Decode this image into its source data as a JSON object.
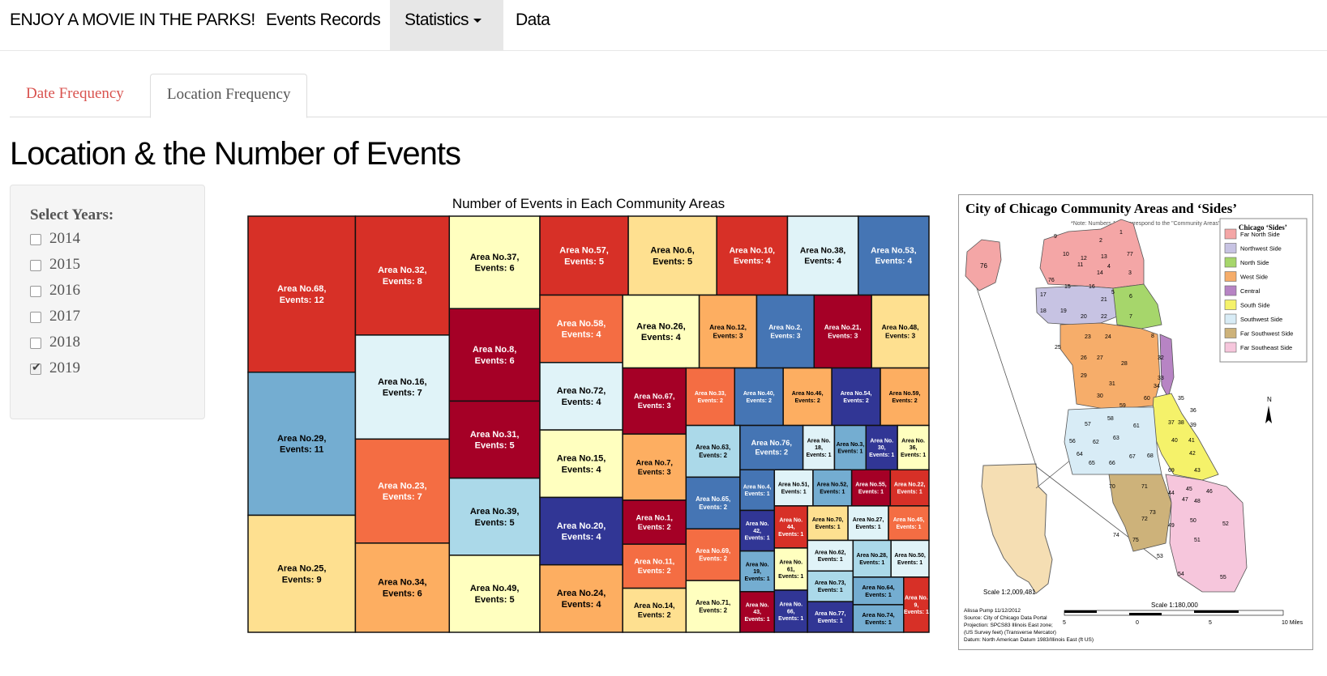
{
  "navbar": {
    "brand": "ENJOY A MOVIE IN THE PARKS!",
    "items": [
      {
        "label": "Events Records"
      },
      {
        "label": "Statistics"
      },
      {
        "label": "Data"
      }
    ]
  },
  "tabs": [
    {
      "label": "Date Frequency"
    },
    {
      "label": "Location Frequency",
      "active": true
    }
  ],
  "page_title": "Location & the Number of Events",
  "sidebar": {
    "label": "Select Years:",
    "years": [
      {
        "label": "2014",
        "checked": false
      },
      {
        "label": "2015",
        "checked": false
      },
      {
        "label": "2016",
        "checked": false
      },
      {
        "label": "2017",
        "checked": false
      },
      {
        "label": "2018",
        "checked": false
      },
      {
        "label": "2019",
        "checked": true
      }
    ]
  },
  "colors": {
    "dark_red": "#a50026",
    "red": "#d73027",
    "orange_red": "#f46d43",
    "orange": "#fdae61",
    "light_orange": "#fee090",
    "pale_yellow": "#ffffbf",
    "pale_blue": "#e0f3f8",
    "light_blue": "#abd9e9",
    "mid_blue": "#74add1",
    "blue": "#4575b4",
    "navy": "#313695"
  },
  "chart_data": {
    "type": "treemap",
    "title": "Number of Events in Each Community Areas",
    "items": [
      {
        "label": "Area No.68, Events: 12",
        "value": 12,
        "color": "#d73027"
      },
      {
        "label": "Area No.29, Events: 11",
        "value": 11,
        "color": "#74add1"
      },
      {
        "label": "Area No.25, Events: 9",
        "value": 9,
        "color": "#fee090"
      },
      {
        "label": "Area No.32, Events: 8",
        "value": 8,
        "color": "#d73027"
      },
      {
        "label": "Area No.16, Events: 7",
        "value": 7,
        "color": "#e0f3f8"
      },
      {
        "label": "Area No.23, Events: 7",
        "value": 7,
        "color": "#f46d43"
      },
      {
        "label": "Area No.34, Events: 6",
        "value": 6,
        "color": "#fdae61"
      },
      {
        "label": "Area No.37, Events: 6",
        "value": 6,
        "color": "#ffffbf"
      },
      {
        "label": "Area No.8, Events: 6",
        "value": 6,
        "color": "#a50026"
      },
      {
        "label": "Area No.31, Events: 5",
        "value": 5,
        "color": "#a50026"
      },
      {
        "label": "Area No.39, Events: 5",
        "value": 5,
        "color": "#abd9e9"
      },
      {
        "label": "Area No.49, Events: 5",
        "value": 5,
        "color": "#ffffbf"
      },
      {
        "label": "Area No.57, Events: 5",
        "value": 5,
        "color": "#d73027"
      },
      {
        "label": "Area No.6, Events: 5",
        "value": 5,
        "color": "#fee090"
      },
      {
        "label": "Area No.10, Events: 4",
        "value": 4,
        "color": "#d73027"
      },
      {
        "label": "Area No.38, Events: 4",
        "value": 4,
        "color": "#e0f3f8"
      },
      {
        "label": "Area No.53, Events: 4",
        "value": 4,
        "color": "#4575b4"
      },
      {
        "label": "Area No.58, Events: 4",
        "value": 4,
        "color": "#f46d43"
      },
      {
        "label": "Area No.72, Events: 4",
        "value": 4,
        "color": "#e0f3f8"
      },
      {
        "label": "Area No.12, Events: 3",
        "value": 3,
        "color": "#fdae61"
      },
      {
        "label": "Area No.15, Events: 4",
        "value": 4,
        "color": "#ffffbf"
      },
      {
        "label": "Area No.20, Events: 4",
        "value": 4,
        "color": "#313695"
      },
      {
        "label": "Area No.24, Events: 4",
        "value": 4,
        "color": "#fdae61"
      },
      {
        "label": "Area No.26, Events: 4",
        "value": 4,
        "color": "#ffffbf"
      },
      {
        "label": "Area No.2, Events: 3",
        "value": 3,
        "color": "#4575b4"
      },
      {
        "label": "Area No.21, Events: 3",
        "value": 3,
        "color": "#a50026"
      },
      {
        "label": "Area No.48, Events: 3",
        "value": 3,
        "color": "#fee090"
      },
      {
        "label": "Area No.67, Events: 3",
        "value": 3,
        "color": "#a50026"
      },
      {
        "label": "Area No.7, Events: 3",
        "value": 3,
        "color": "#fdae61"
      },
      {
        "label": "Area No.1, Events: 2",
        "value": 2,
        "color": "#a50026"
      },
      {
        "label": "Area No.11, Events: 2",
        "value": 2,
        "color": "#f46d43"
      },
      {
        "label": "Area No.14, Events: 2",
        "value": 2,
        "color": "#fee090"
      },
      {
        "label": "Area No.33, Events: 2",
        "value": 2,
        "color": "#f46d43"
      },
      {
        "label": "Area No.40, Events: 2",
        "value": 2,
        "color": "#4575b4"
      },
      {
        "label": "Area No.46, Events: 2",
        "value": 2,
        "color": "#fdae61"
      },
      {
        "label": "Area No.54, Events: 2",
        "value": 2,
        "color": "#313695"
      },
      {
        "label": "Area No.59, Events: 2",
        "value": 2,
        "color": "#fdae61"
      },
      {
        "label": "Area No.63, Events: 2",
        "value": 2,
        "color": "#abd9e9"
      },
      {
        "label": "Area No.65, Events: 2",
        "value": 2,
        "color": "#4575b4"
      },
      {
        "label": "Area No.69, Events: 2",
        "value": 2,
        "color": "#f46d43"
      },
      {
        "label": "Area No.71, Events: 2",
        "value": 2,
        "color": "#ffffbf"
      },
      {
        "label": "Area No.76, Events: 2",
        "value": 2,
        "color": "#4575b4"
      },
      {
        "label": "Area No.18, Events: 1",
        "value": 1,
        "color": "#e0f3f8"
      },
      {
        "label": "Area No.3, Events: 1",
        "value": 1,
        "color": "#74add1"
      },
      {
        "label": "Area No.30, Events: 1",
        "value": 1,
        "color": "#313695"
      },
      {
        "label": "Area No.36, Events: 1",
        "value": 1,
        "color": "#ffffbf"
      },
      {
        "label": "Area No.4, Events: 1",
        "value": 1,
        "color": "#4575b4"
      },
      {
        "label": "Area No.42, Events: 1",
        "value": 1,
        "color": "#313695"
      },
      {
        "label": "Area No.19, Events: 1",
        "value": 1,
        "color": "#74add1"
      },
      {
        "label": "Area No.43, Events: 1",
        "value": 1,
        "color": "#a50026"
      },
      {
        "label": "Area No.51, Events: 1",
        "value": 1,
        "color": "#e0f3f8"
      },
      {
        "label": "Area No.52, Events: 1",
        "value": 1,
        "color": "#74add1"
      },
      {
        "label": "Area No.55, Events: 1",
        "value": 1,
        "color": "#a50026"
      },
      {
        "label": "Area No.22, Events: 1",
        "value": 1,
        "color": "#d73027"
      },
      {
        "label": "Area No.44, Events: 1",
        "value": 1,
        "color": "#d73027"
      },
      {
        "label": "Area No.61, Events: 1",
        "value": 1,
        "color": "#ffffbf"
      },
      {
        "label": "Area No.66, Events: 1",
        "value": 1,
        "color": "#313695"
      },
      {
        "label": "Area No.70, Events: 1",
        "value": 1,
        "color": "#fee090"
      },
      {
        "label": "Area No.27, Events: 1",
        "value": 1,
        "color": "#e0f3f8"
      },
      {
        "label": "Area No.45, Events: 1",
        "value": 1,
        "color": "#f46d43"
      },
      {
        "label": "Area No.62, Events: 1",
        "value": 1,
        "color": "#e0f3f8"
      },
      {
        "label": "Area No.73, Events: 1",
        "value": 1,
        "color": "#abd9e9"
      },
      {
        "label": "Area No.77, Events: 1",
        "value": 1,
        "color": "#313695"
      },
      {
        "label": "Area No.28, Events: 1",
        "value": 1,
        "color": "#abd9e9"
      },
      {
        "label": "Area No.50, Events: 1",
        "value": 1,
        "color": "#e0f3f8"
      },
      {
        "label": "Area No.64, Events: 1",
        "value": 1,
        "color": "#74add1"
      },
      {
        "label": "Area No.74, Events: 1",
        "value": 1,
        "color": "#74add1"
      },
      {
        "label": "Area No.9, Events: 1",
        "value": 1,
        "color": "#d73027"
      }
    ]
  },
  "map": {
    "title": "City of Chicago Community Areas and ‘Sides’",
    "note": "*Note: Numbers 1-77 correspond to the \"Community Areas\"",
    "legend_title": "Chicago ‘Sides’",
    "legend": [
      {
        "label": "Far North Side",
        "color": "#f4a6a6"
      },
      {
        "label": "Northwest Side",
        "color": "#c7c3e3"
      },
      {
        "label": "North Side",
        "color": "#a6d66b"
      },
      {
        "label": "West Side",
        "color": "#f6ad6a"
      },
      {
        "label": "Central",
        "color": "#b784c4"
      },
      {
        "label": "South Side",
        "color": "#f5f26a"
      },
      {
        "label": "Southwest Side",
        "color": "#d8ecf6"
      },
      {
        "label": "Far Southwest Side",
        "color": "#cdb27a"
      },
      {
        "label": "Far Southeast Side",
        "color": "#f6c6dc"
      }
    ],
    "scale_small": "Scale 1:2,009,481",
    "scale_large": "Scale 1:180,000",
    "scale_ticks": [
      "5",
      "0",
      "5",
      "10 Miles"
    ],
    "north": "N",
    "credits": [
      "Alissa Pump 11/12/2012",
      "Source: City of Chicago Data Portal",
      "Projection: SPCS83 Illinois East zone;",
      "(US Survey feet) (Transverse Mercator)",
      "Datum: North American Datum 1983/Illinois East (ft US)"
    ]
  }
}
